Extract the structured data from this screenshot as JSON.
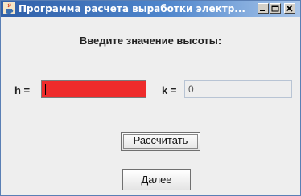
{
  "window": {
    "title": "Программа расчета выработки электр...",
    "icon": "java-cup-icon",
    "controls": [
      "minimize",
      "maximize",
      "close"
    ]
  },
  "form": {
    "prompt": "Введите значение высоты:",
    "h_label": "h =",
    "h_value": "",
    "k_label": "k =",
    "k_value": "0"
  },
  "buttons": {
    "calculate": "Рассчитать",
    "next": "Далее"
  },
  "colors": {
    "h_field_background": "#ee2b2b",
    "title_gradient_start": "#2f5fa8"
  }
}
